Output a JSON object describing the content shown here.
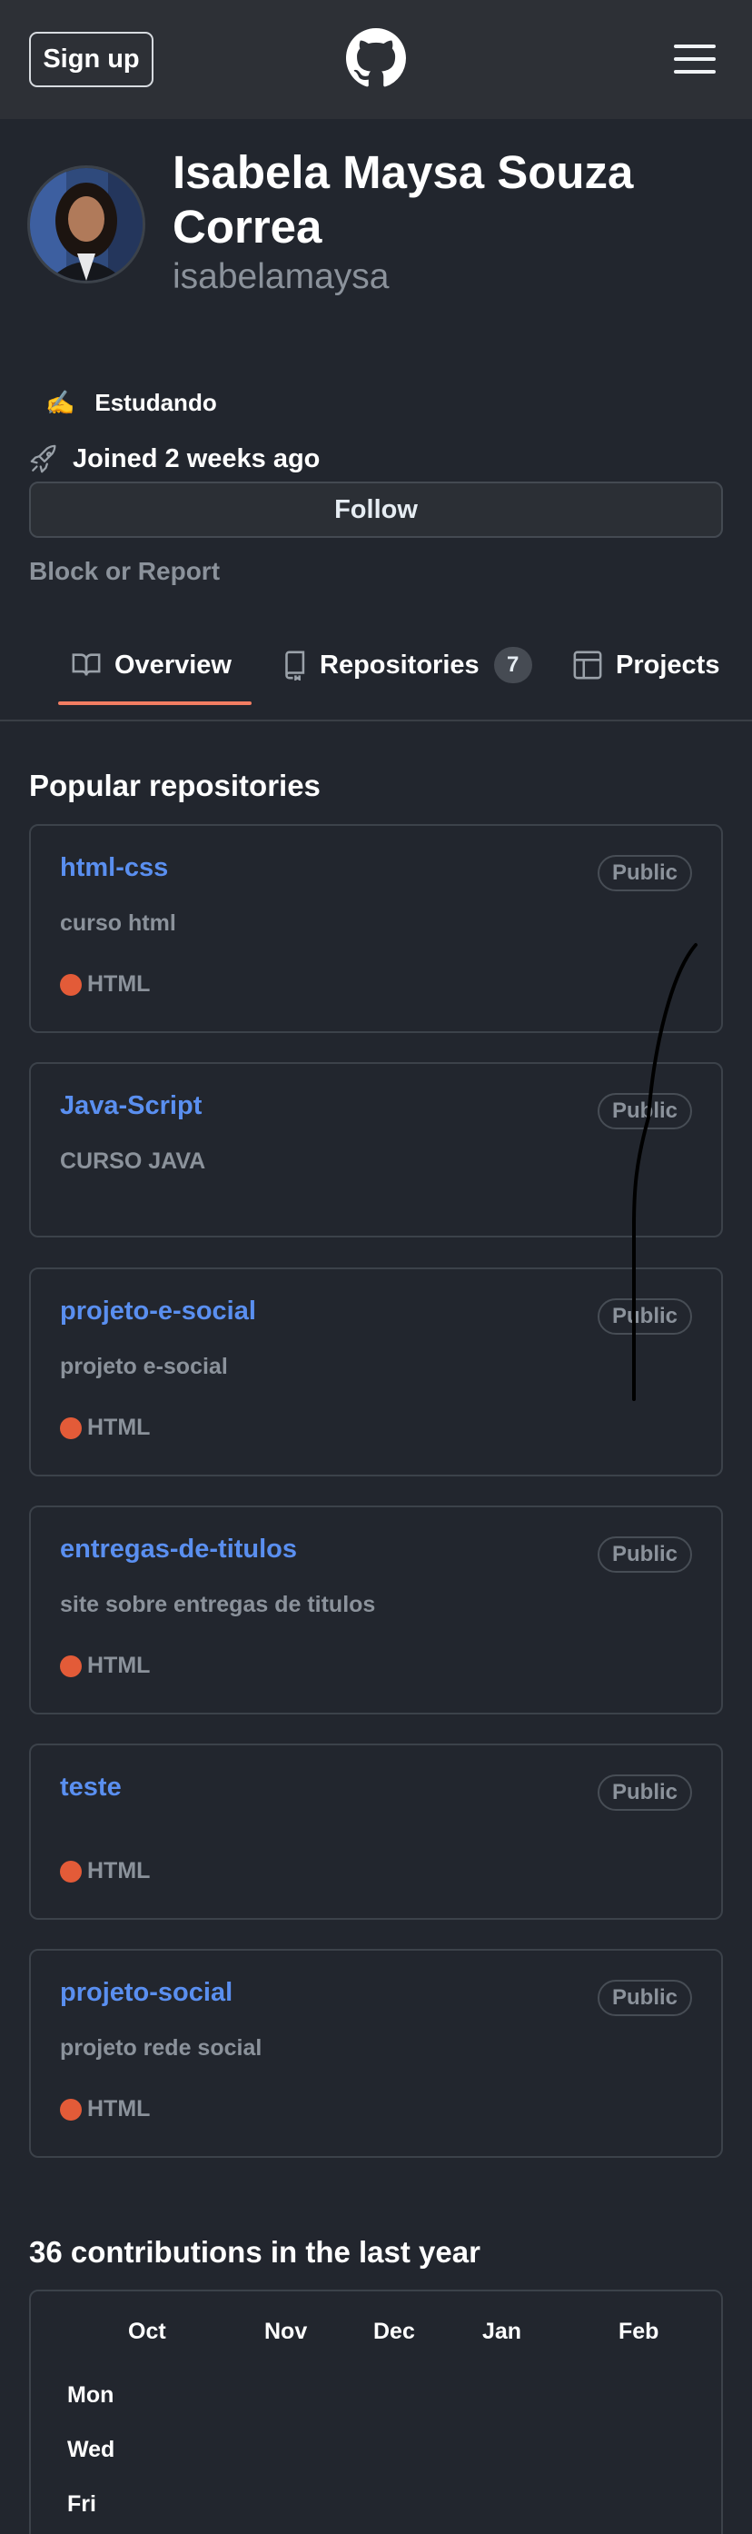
{
  "header": {
    "signup_label": "Sign up",
    "logo_icon": "github-octocat-icon",
    "menu_icon": "hamburger-menu-icon"
  },
  "profile": {
    "full_name": "Isabela Maysa Souza Correa",
    "login": "isabelamaysa",
    "status_emoji": "✍️",
    "status_text": "Estudando",
    "joined": "Joined 2 weeks ago",
    "follow_label": "Follow",
    "block_label": "Block or Report"
  },
  "tabs": [
    {
      "label": "Overview",
      "icon": "book-icon",
      "selected": true
    },
    {
      "label": "Repositories",
      "icon": "repo-icon",
      "count": "7"
    },
    {
      "label": "Projects",
      "icon": "table-icon"
    }
  ],
  "popular": {
    "title": "Popular repositories",
    "repos": [
      {
        "name": "html-css",
        "visibility": "Public",
        "description": "curso html",
        "language": "HTML"
      },
      {
        "name": "Java-Script",
        "visibility": "Public",
        "description": "CURSO JAVA",
        "language": ""
      },
      {
        "name": "projeto-e-social",
        "visibility": "Public",
        "description": "projeto e-social",
        "language": "HTML"
      },
      {
        "name": "entregas-de-titulos",
        "visibility": "Public",
        "description": "site sobre entregas de titulos",
        "language": "HTML"
      },
      {
        "name": "teste",
        "visibility": "Public",
        "description": "",
        "language": "HTML"
      },
      {
        "name": "projeto-social",
        "visibility": "Public",
        "description": "projeto rede social",
        "language": "HTML"
      }
    ]
  },
  "contributions": {
    "title": "36 contributions in the last year",
    "months": [
      "Oct",
      "Nov",
      "Dec",
      "Jan",
      "Feb"
    ],
    "days": [
      "Mon",
      "Wed",
      "Fri"
    ]
  },
  "colors": {
    "accent_underline": "#f27d62",
    "link": "#5a8ff0",
    "html_language": "#e35b38"
  }
}
